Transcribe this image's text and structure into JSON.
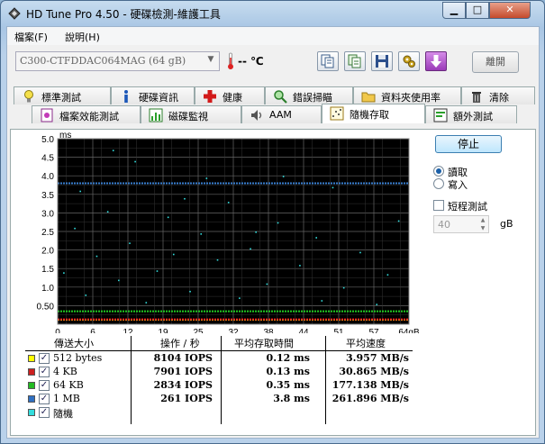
{
  "window": {
    "title": "HD Tune Pro 4.50 - 硬碟檢測-維護工具"
  },
  "menu": {
    "file": "檔案(F)",
    "help": "說明(H)"
  },
  "toolbar": {
    "drive": "C300-CTFDDAC064MAG (64 gB)",
    "temperature": "-- ℃",
    "exit_label": "離開"
  },
  "tabs_row1": [
    "標準測試",
    "硬碟資訊",
    "健康",
    "錯誤掃瞄",
    "資料夾使用率",
    "清除"
  ],
  "tabs_row2": [
    "檔案效能測試",
    "磁碟監視",
    "AAM",
    "隨機存取",
    "額外測試"
  ],
  "active_tab": "隨機存取",
  "controls": {
    "stop_label": "停止",
    "read_label": "讀取",
    "write_label": "寫入",
    "short_test_label": "短程測試",
    "short_test_value": "40",
    "short_test_unit": "gB"
  },
  "colors": {
    "plot_bg": "#000000",
    "grid": "#666666",
    "series_512": "#ffff00",
    "series_4k": "#ff2020",
    "series_64k": "#22cc22",
    "series_1m": "#3a7fd0",
    "series_random": "#33dddd"
  },
  "chart_data": {
    "type": "scatter",
    "ylabel": "ms",
    "xlim": [
      0,
      64
    ],
    "ylim": [
      0,
      5.0
    ],
    "x_ticks": [
      "0",
      "6",
      "12",
      "19",
      "25",
      "32",
      "38",
      "44",
      "51",
      "57",
      "64gB"
    ],
    "y_ticks": [
      "0.50",
      "1.0",
      "1.5",
      "2.0",
      "2.5",
      "3.0",
      "3.5",
      "4.0",
      "4.5",
      "5.0"
    ],
    "grid": true,
    "series": [
      {
        "name": "512 bytes",
        "typical_ms": 0.12
      },
      {
        "name": "4 KB",
        "typical_ms": 0.13
      },
      {
        "name": "64 KB",
        "typical_ms": 0.35
      },
      {
        "name": "1 MB",
        "typical_ms": 3.8
      }
    ],
    "random_outliers_ms": [
      [
        10,
        4.7
      ],
      [
        14,
        4.4
      ],
      [
        4,
        3.6
      ],
      [
        23,
        3.4
      ],
      [
        31,
        3.3
      ],
      [
        9,
        3.05
      ],
      [
        20,
        2.9
      ],
      [
        40,
        2.75
      ],
      [
        3,
        2.6
      ],
      [
        26,
        2.45
      ],
      [
        47,
        2.35
      ],
      [
        13,
        2.2
      ],
      [
        35,
        2.05
      ],
      [
        55,
        1.95
      ],
      [
        7,
        1.85
      ],
      [
        29,
        1.75
      ],
      [
        44,
        1.6
      ],
      [
        18,
        1.45
      ],
      [
        60,
        1.35
      ],
      [
        11,
        1.2
      ],
      [
        38,
        1.1
      ],
      [
        52,
        1.0
      ],
      [
        24,
        0.9
      ],
      [
        5,
        0.8
      ],
      [
        33,
        0.72
      ],
      [
        48,
        0.65
      ],
      [
        16,
        0.6
      ],
      [
        58,
        0.55
      ],
      [
        41,
        4.0
      ],
      [
        27,
        3.95
      ],
      [
        50,
        3.7
      ],
      [
        36,
        2.5
      ],
      [
        21,
        1.9
      ],
      [
        62,
        2.8
      ],
      [
        1,
        1.4
      ]
    ]
  },
  "table": {
    "headers": [
      "傳送大小",
      "操作 / 秒",
      "平均存取時間",
      "平均速度"
    ],
    "rows": [
      {
        "name": "512 bytes",
        "color": "#ffff00",
        "iops": "8104 IOPS",
        "time": "0.12 ms",
        "speed": "3.957 MB/s"
      },
      {
        "name": "4 KB",
        "color": "#cc2020",
        "iops": "7901 IOPS",
        "time": "0.13 ms",
        "speed": "30.865 MB/s"
      },
      {
        "name": "64 KB",
        "color": "#22bb22",
        "iops": "2834 IOPS",
        "time": "0.35 ms",
        "speed": "177.138 MB/s"
      },
      {
        "name": "1 MB",
        "color": "#2f6fc2",
        "iops": "261 IOPS",
        "time": "3.8 ms",
        "speed": "261.896 MB/s"
      },
      {
        "name": "隨機",
        "color": "#33dddd",
        "iops": "",
        "time": "",
        "speed": ""
      }
    ]
  }
}
